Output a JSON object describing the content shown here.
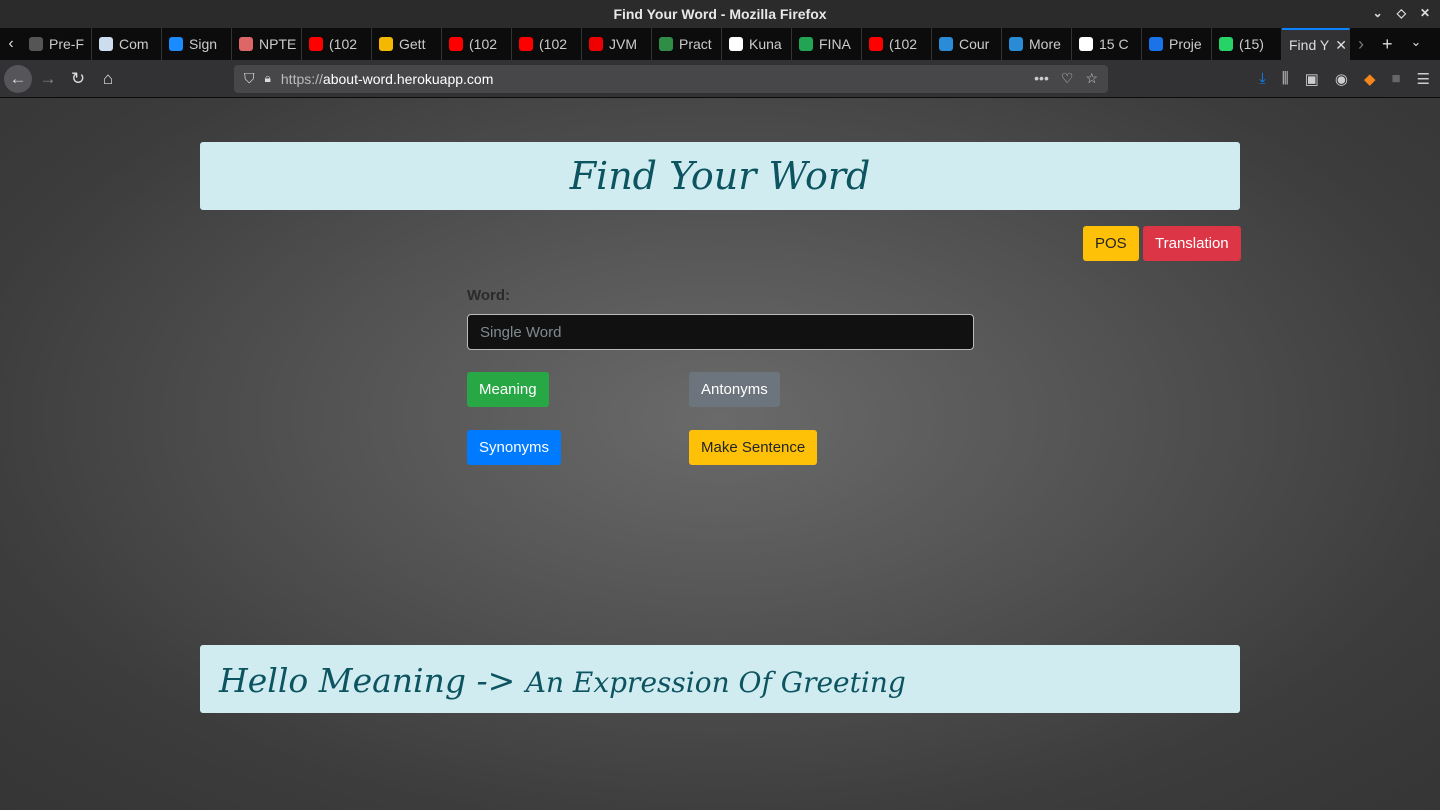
{
  "window": {
    "title": "Find Your Word - Mozilla Firefox"
  },
  "tabs": [
    {
      "label": "Pre-F",
      "color": "#555"
    },
    {
      "label": "Com",
      "color": "#cde"
    },
    {
      "label": "Sign",
      "color": "#1a8cff"
    },
    {
      "label": "NPTE",
      "color": "#d66"
    },
    {
      "label": "(102",
      "color": "#f00"
    },
    {
      "label": "Gett",
      "color": "#f5b800"
    },
    {
      "label": "(102",
      "color": "#f00"
    },
    {
      "label": "(102",
      "color": "#f00"
    },
    {
      "label": "JVM",
      "color": "#e00"
    },
    {
      "label": "Pract",
      "color": "#2f8d46"
    },
    {
      "label": "Kuna",
      "color": "#fff"
    },
    {
      "label": "FINA",
      "color": "#23a455"
    },
    {
      "label": "(102",
      "color": "#f00"
    },
    {
      "label": "Cour",
      "color": "#2a8bd6"
    },
    {
      "label": "More",
      "color": "#2a8bd6"
    },
    {
      "label": "15 C",
      "color": "#fff"
    },
    {
      "label": "Proje",
      "color": "#1a73e8"
    },
    {
      "label": "(15)",
      "color": "#25d366"
    }
  ],
  "active_tab": {
    "label": "Find Y"
  },
  "url": {
    "prefix": "https://",
    "host": "about-word.herokuapp.com"
  },
  "header": {
    "title": "Find Your Word"
  },
  "buttons": {
    "pos": "POS",
    "translation": "Translation",
    "meaning": "Meaning",
    "antonyms": "Antonyms",
    "synonyms": "Synonyms",
    "make_sentence": "Make Sentence"
  },
  "form": {
    "label": "Word:",
    "placeholder": "Single Word",
    "value": ""
  },
  "result": {
    "word": "Hello Meaning ->",
    "meaning": "An Expression Of Greeting"
  },
  "colors": {
    "warning": "#ffc107",
    "danger": "#dc3545",
    "success": "#28a745",
    "secondary": "#6c757d",
    "primary": "#007bff",
    "info_bg": "#d1ecf1"
  }
}
